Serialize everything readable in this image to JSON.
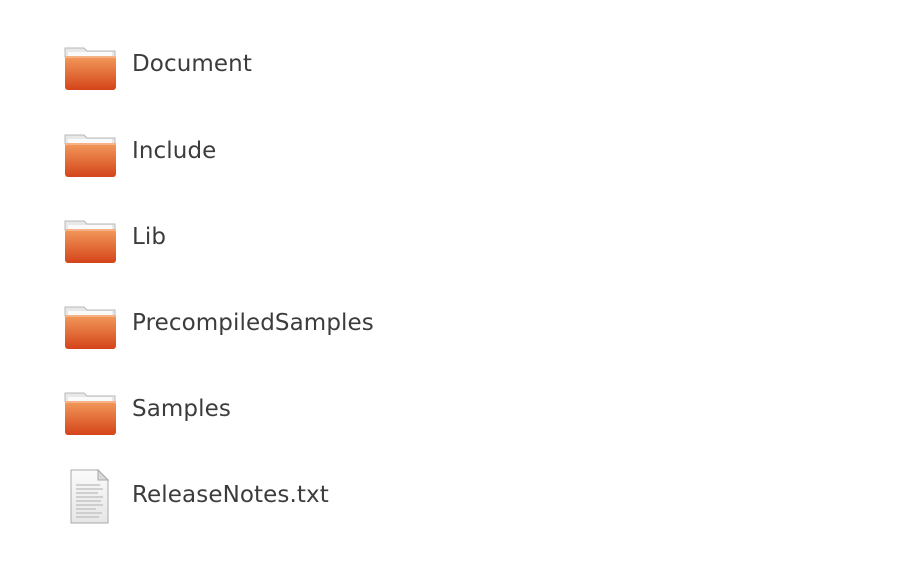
{
  "files": [
    {
      "name": "Document",
      "icon": "folder-icon"
    },
    {
      "name": "Include",
      "icon": "folder-icon"
    },
    {
      "name": "Lib",
      "icon": "folder-icon"
    },
    {
      "name": "PrecompiledSamples",
      "icon": "folder-icon"
    },
    {
      "name": "Samples",
      "icon": "folder-icon"
    },
    {
      "name": "ReleaseNotes.txt",
      "icon": "text-file-icon"
    }
  ],
  "colors": {
    "folder_top": "#f08a4b",
    "folder_bottom": "#d7491a",
    "folder_tab": "#f3f3f3",
    "text": "#3c3c3c"
  }
}
